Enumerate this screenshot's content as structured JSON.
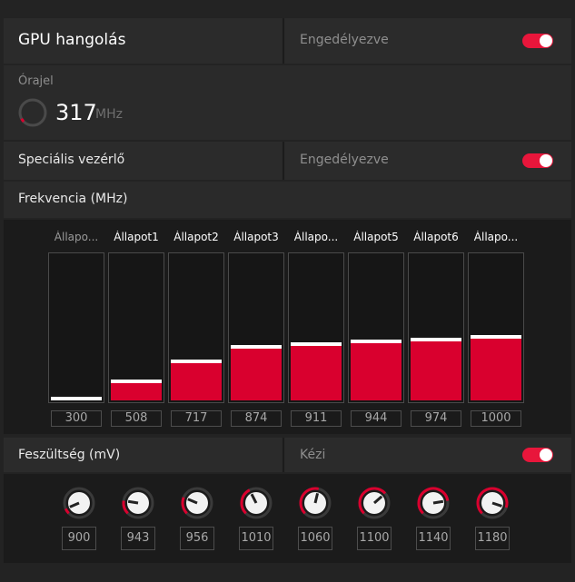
{
  "gpu": {
    "title": "GPU hangolás",
    "status": "Engedélyezve"
  },
  "clock": {
    "label": "Órajel",
    "value": "317",
    "unit": "MHz",
    "fraction": 0.06
  },
  "special": {
    "title": "Speciális vezérlő",
    "status": "Engedélyezve"
  },
  "frequency": {
    "title": "Frekvencia (MHz)",
    "states": [
      {
        "label": "Állapo...",
        "value": "300",
        "level": 0.0,
        "dim": true
      },
      {
        "label": "Állapot1",
        "value": "508",
        "level": 0.12,
        "dim": false
      },
      {
        "label": "Állapot2",
        "value": "717",
        "level": 0.25,
        "dim": false
      },
      {
        "label": "Állapot3",
        "value": "874",
        "level": 0.35,
        "dim": false
      },
      {
        "label": "Állapo...",
        "value": "911",
        "level": 0.37,
        "dim": false
      },
      {
        "label": "Állapot5",
        "value": "944",
        "level": 0.39,
        "dim": false
      },
      {
        "label": "Állapot6",
        "value": "974",
        "level": 0.4,
        "dim": false
      },
      {
        "label": "Állapo...",
        "value": "1000",
        "level": 0.42,
        "dim": false
      }
    ]
  },
  "voltage": {
    "title": "Feszültség (mV)",
    "mode": "Kézi",
    "states": [
      {
        "value": "900",
        "level": 0.08
      },
      {
        "value": "943",
        "level": 0.2
      },
      {
        "value": "956",
        "level": 0.25
      },
      {
        "value": "1010",
        "level": 0.4
      },
      {
        "value": "1060",
        "level": 0.55
      },
      {
        "value": "1100",
        "level": 0.68
      },
      {
        "value": "1140",
        "level": 0.8
      },
      {
        "value": "1180",
        "level": 0.9
      }
    ]
  },
  "colors": {
    "accent": "#e8163b",
    "fill": "#d9002e"
  }
}
